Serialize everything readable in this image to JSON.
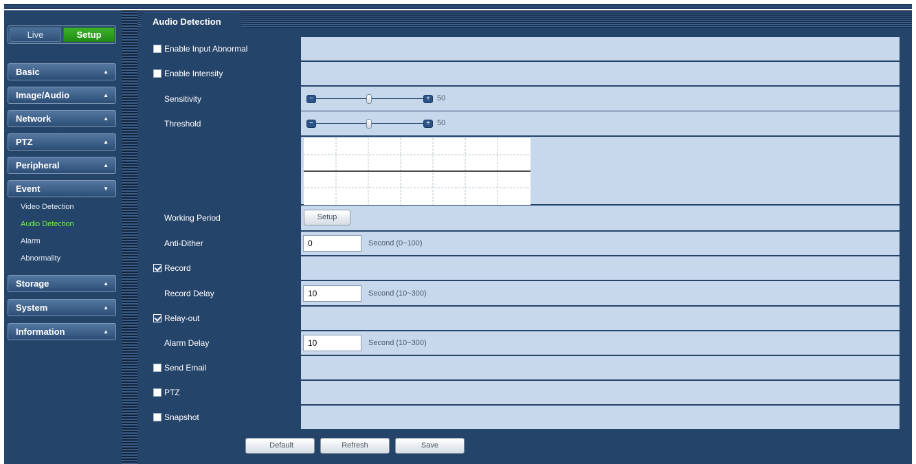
{
  "nav": {
    "live_label": "Live",
    "setup_label": "Setup",
    "menu": [
      {
        "label": "Basic",
        "arrow": "▲"
      },
      {
        "label": "Image/Audio",
        "arrow": "▲"
      },
      {
        "label": "Network",
        "arrow": "▲"
      },
      {
        "label": "PTZ",
        "arrow": "▲"
      },
      {
        "label": "Peripheral",
        "arrow": "▲"
      },
      {
        "label": "Event",
        "arrow": "▼"
      },
      {
        "label": "Storage",
        "arrow": "▲"
      },
      {
        "label": "System",
        "arrow": "▲"
      },
      {
        "label": "Information",
        "arrow": "▲"
      }
    ],
    "event_sub": [
      "Video Detection",
      "Audio Detection",
      "Alarm",
      "Abnormality"
    ],
    "active_sub": "Audio Detection"
  },
  "tab": {
    "title": "Audio Detection"
  },
  "form": {
    "enable_input_abnormal": {
      "label": "Enable Input Abnormal",
      "checked": false
    },
    "enable_intensity": {
      "label": "Enable Intensity",
      "checked": false
    },
    "sensitivity": {
      "label": "Sensitivity",
      "value": "50",
      "level": 0.5
    },
    "threshold": {
      "label": "Threshold",
      "value": "50",
      "level": 0.5
    },
    "working_period": {
      "label": "Working Period",
      "button": "Setup"
    },
    "anti_dither": {
      "label": "Anti-Dither",
      "value": "0",
      "unit": "Second (0~100)"
    },
    "record": {
      "label": "Record",
      "checked": true
    },
    "record_delay": {
      "label": "Record Delay",
      "value": "10",
      "unit": "Second (10~300)"
    },
    "relay_out": {
      "label": "Relay-out",
      "checked": true
    },
    "alarm_delay": {
      "label": "Alarm Delay",
      "value": "10",
      "unit": "Second (10~300)"
    },
    "send_email": {
      "label": "Send Email",
      "checked": false
    },
    "ptz": {
      "label": "PTZ",
      "checked": false
    },
    "snapshot": {
      "label": "Snapshot",
      "checked": false
    }
  },
  "actions": {
    "default_label": "Default",
    "refresh_label": "Refresh",
    "save_label": "Save"
  },
  "colors": {
    "accent_active": "#6ef04a",
    "setup_green": "#1e8e12",
    "panel": "#25446a",
    "value_cell": "#c8d8ec"
  }
}
